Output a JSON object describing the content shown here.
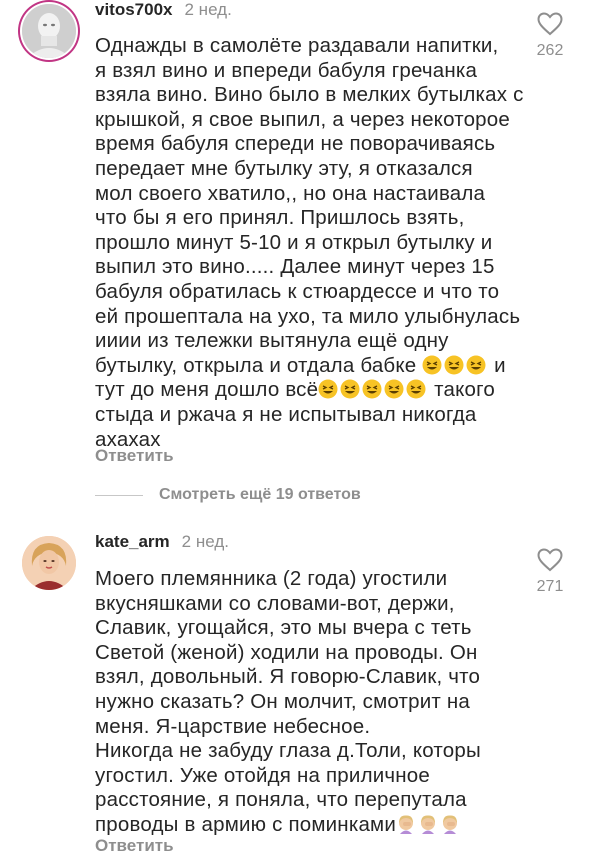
{
  "comments": [
    {
      "username": "vitos700x",
      "time": "2 нед.",
      "likes": "262",
      "lines": [
        "Однажды в самолёте раздавали напитки,",
        "я взял вино и впереди бабуля гречанка",
        "взяла вино. Вино было в мелких бутылках с",
        "крышкой, я свое выпил, а через некоторое",
        "время бабуля спереди не поворачиваясь",
        "передает мне бутылку эту, я отказался",
        "мол своего хватило,, но она настаивала",
        "что бы я его принял. Пришлось взять,",
        "прошло минут 5-10 и я открыл бутылку и",
        "выпил это вино..... Далее минут через 15",
        "бабуля обратилась к стюардессе и что то",
        "ей прошептала на ухо, та мило улыбнулась",
        "ииии из тележки вытянула ещё одну",
        "бутылку, открыла и отдала бабке",
        "и",
        "тут до меня дошло всё",
        "такого",
        "стыда и ржача я не испытывал никогда",
        "ахахах"
      ],
      "reply_label": "Ответить"
    },
    {
      "username": "kate_arm",
      "time": "2 нед.",
      "likes": "271",
      "lines": [
        "Моего племянника (2 года) угостили",
        "вкусняшками со словами-вот, держи,",
        "Славик, угощайся, это мы вчера с теть",
        "Светой (женой) ходили на проводы. Он",
        "взял, довольный. Я говорю-Славик, что",
        "нужно сказать? Он молчит, смотрит на",
        "меня. Я-царствие небесное.",
        "Никогда не забуду глаза д.Толи, которы",
        "угостил. Уже отойдя на приличное",
        "расстояние, я поняла, что перепутала",
        "проводы в армию с поминками"
      ],
      "reply_label": "Ответить"
    }
  ],
  "more_replies": "Смотреть ещё 19 ответов",
  "colors": {
    "ring": "#c13584",
    "secondary_text": "#8e8e8e",
    "emoji_yellow": "#f7c325"
  },
  "icons": [
    "heart-icon",
    "grinning-squinting-face-emoji",
    "facepalm-emoji"
  ]
}
